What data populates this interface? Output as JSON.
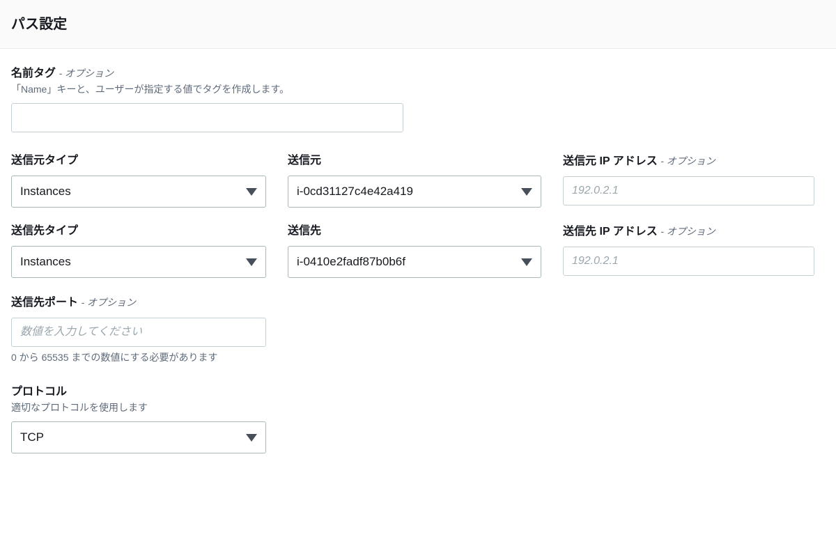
{
  "header": {
    "title": "パス設定"
  },
  "fields": {
    "name_tag": {
      "label": "名前タグ",
      "optional_suffix": "- オプション",
      "description": "「Name」キーと、ユーザーが指定する値でタグを作成します。",
      "value": "",
      "placeholder": ""
    },
    "source_type": {
      "label": "送信元タイプ",
      "value": "Instances"
    },
    "source": {
      "label": "送信元",
      "value": "i-0cd31127c4e42a419"
    },
    "source_ip": {
      "label": "送信元 IP アドレス",
      "optional_suffix": "- オプション",
      "value": "",
      "placeholder": "192.0.2.1"
    },
    "destination_type": {
      "label": "送信先タイプ",
      "value": "Instances"
    },
    "destination": {
      "label": "送信先",
      "value": "i-0410e2fadf87b0b6f"
    },
    "destination_ip": {
      "label": "送信先 IP アドレス",
      "optional_suffix": "- オプション",
      "value": "",
      "placeholder": "192.0.2.1"
    },
    "destination_port": {
      "label": "送信先ポート",
      "optional_suffix": "- オプション",
      "value": "",
      "placeholder": "数値を入力してください",
      "hint": "0 から 65535 までの数値にする必要があります"
    },
    "protocol": {
      "label": "プロトコル",
      "description": "適切なプロトコルを使用します",
      "value": "TCP"
    }
  },
  "icons": {
    "chevron_down": "chevron-down-icon"
  },
  "colors": {
    "header_background": "#fafafa",
    "text_primary": "#16191f",
    "text_secondary": "#5f6b7a",
    "input_border": "#c6cfd4",
    "select_border": "#aab7b8",
    "chevron": "#474f5b",
    "placeholder": "#9aa7ad"
  }
}
